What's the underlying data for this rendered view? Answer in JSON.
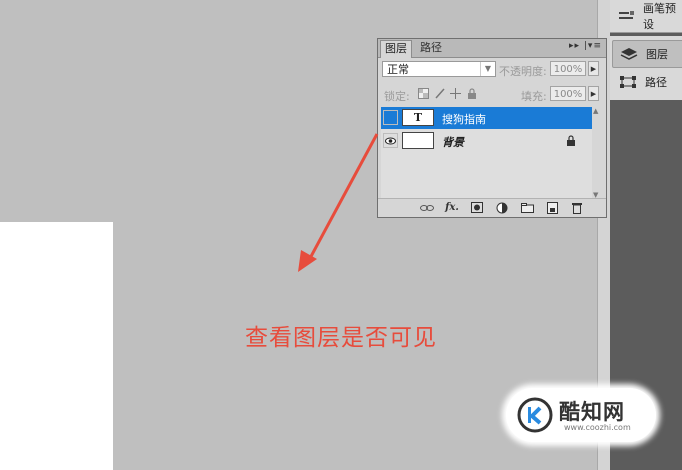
{
  "dock": {
    "top_item": "画笔预设",
    "layers_label": "图层",
    "paths_label": "路径"
  },
  "layers_panel": {
    "tabs": [
      "图层",
      "路径"
    ],
    "menu_glyph": "▸▸ |▾≡",
    "blend_mode": "正常",
    "opacity_label": "不透明度:",
    "opacity_value": "100%",
    "lock_label": "锁定:",
    "fill_label": "填充:",
    "fill_value": "100%",
    "layers": [
      {
        "name": "搜狗指南",
        "thumb": "T",
        "selected": true,
        "visible": false
      },
      {
        "name": "背景",
        "thumb": "",
        "selected": false,
        "visible": true,
        "locked": true
      }
    ],
    "footer_icons": [
      "link-icon",
      "fx-icon",
      "mask-icon",
      "adjustment-icon",
      "group-icon",
      "new-layer-icon",
      "trash-icon"
    ],
    "fx_label": "fx."
  },
  "annotation": {
    "text": "查看图层是否可见",
    "color": "#e74c3c"
  },
  "watermark": {
    "name": "酷知网",
    "url": "www.coozhi.com"
  },
  "colors": {
    "selection": "#1a7bd6",
    "arrow": "#e74c3c"
  }
}
